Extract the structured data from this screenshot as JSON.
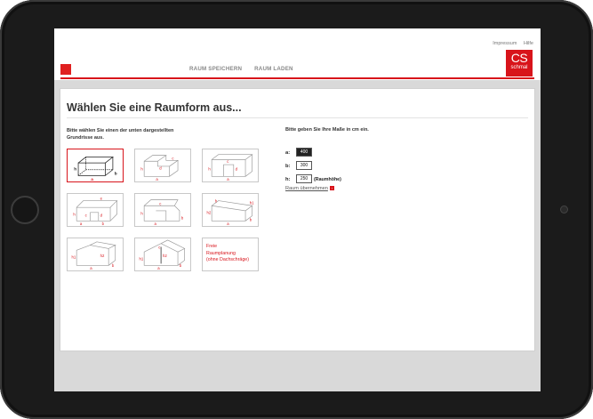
{
  "header": {
    "links": [
      "Impressum",
      "Hilfe"
    ],
    "nav": [
      "RAUM SPEICHERN",
      "RAUM LADEN"
    ],
    "logo_big": "CS",
    "logo_small": "schmal"
  },
  "main": {
    "title": "Wählen Sie eine Raumform aus...",
    "instruction_left": "Bitte wählen Sie einen der unten dargestellten Grundrisse aus.",
    "instruction_right": "Bitte geben Sie Ihre Maße in cm ein.",
    "shapes": [
      {
        "id": "rect",
        "labels": [
          "h",
          "a",
          "b"
        ]
      },
      {
        "id": "l-shape",
        "labels": [
          "h",
          "a",
          "d",
          "c"
        ]
      },
      {
        "id": "u-shape",
        "labels": [
          "h",
          "a",
          "c",
          "d"
        ]
      },
      {
        "id": "l-step",
        "labels": [
          "h",
          "a",
          "b",
          "c",
          "d",
          "e"
        ]
      },
      {
        "id": "bay",
        "labels": [
          "h",
          "a",
          "b",
          "c"
        ]
      },
      {
        "id": "slope",
        "labels": [
          "h",
          "h1",
          "h2",
          "a",
          "b"
        ]
      },
      {
        "id": "gable",
        "labels": [
          "h1",
          "h2",
          "a",
          "b"
        ]
      },
      {
        "id": "gable-center",
        "labels": [
          "h1",
          "h2",
          "c",
          "a",
          "b"
        ]
      }
    ],
    "free_planning": [
      "Freie",
      "Raumplanung",
      "(ohne Dachschräge)"
    ],
    "dims": [
      {
        "label": "a:",
        "value": "400",
        "active": true
      },
      {
        "label": "b:",
        "value": "300",
        "active": false
      },
      {
        "label": "h:",
        "value": "250",
        "active": false,
        "note": "(Raumhöhe)"
      }
    ],
    "take_link": "Raum übernehmen",
    "take_arrow": "›"
  },
  "colors": {
    "accent": "#d8141b",
    "bezel": "#1b1b1b",
    "screen_bg": "#d9d9d9"
  }
}
